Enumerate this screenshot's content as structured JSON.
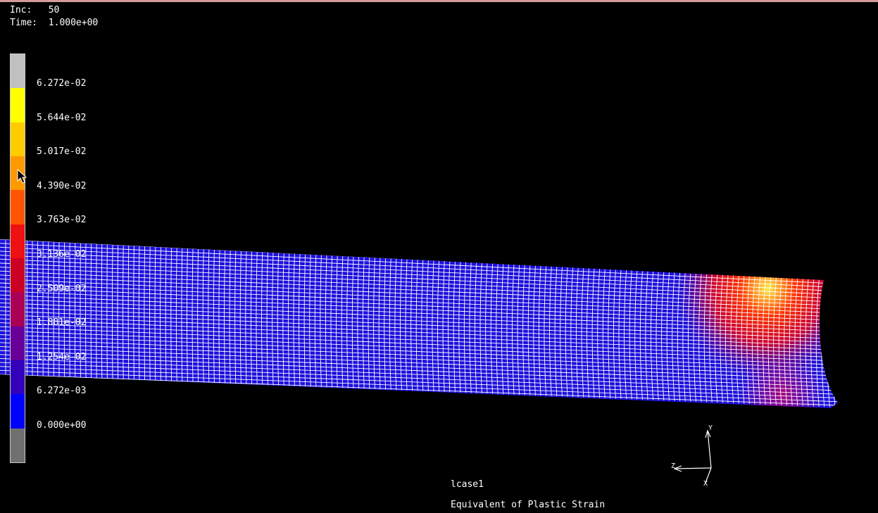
{
  "info": {
    "inc_label": "Inc:",
    "inc_value": "50",
    "time_label": "Time:",
    "time_value": "1.000e+00"
  },
  "legend": {
    "swatches": [
      {
        "color": "#c0c0c0"
      },
      {
        "color": "#ffff00"
      },
      {
        "color": "#ffcc00"
      },
      {
        "color": "#ff9900"
      },
      {
        "color": "#ff5500"
      },
      {
        "color": "#ee1111"
      },
      {
        "color": "#cc0022"
      },
      {
        "color": "#aa0055"
      },
      {
        "color": "#660099"
      },
      {
        "color": "#3300bb"
      },
      {
        "color": "#0000ff"
      },
      {
        "color": "#707070"
      }
    ],
    "labels": [
      "6.272e-02",
      "5.644e-02",
      "5.017e-02",
      "4.390e-02",
      "3.763e-02",
      "3.136e-02",
      "2.509e-02",
      "1.881e-02",
      "1.254e-02",
      "6.272e-03",
      "0.000e+00"
    ]
  },
  "mesh": {
    "base_color": "#1c10dd",
    "grid_color": "#ffffff",
    "hotspot_colors": [
      "#ffee44",
      "#ff3300",
      "#cc0033",
      "#660088"
    ]
  },
  "axes": {
    "x": "X",
    "y": "Y",
    "z": "Z"
  },
  "footer": {
    "load_case": "lcase1",
    "result_name": "Equivalent of Plastic Strain"
  }
}
